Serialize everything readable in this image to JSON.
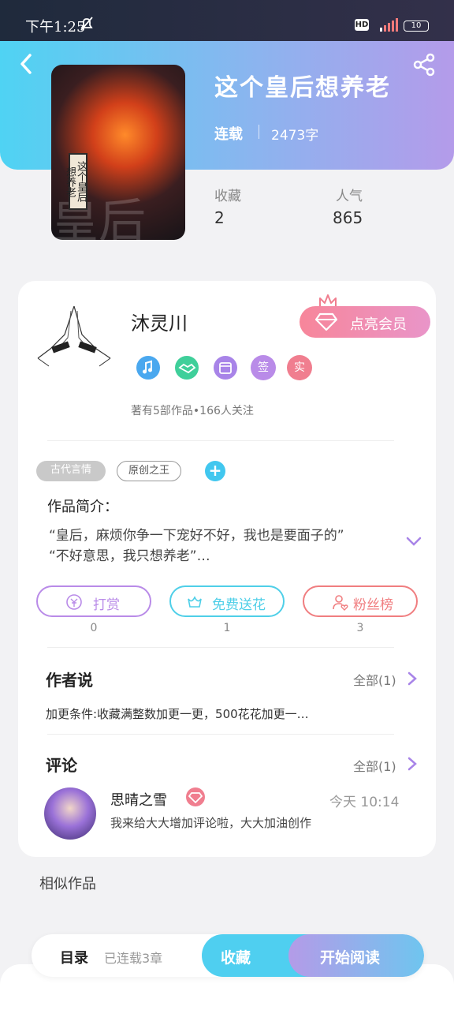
{
  "status_bar": {
    "time": "下午1:25",
    "hd": "HD",
    "battery": "10"
  },
  "book": {
    "title": "这个皇后想养老",
    "status": "连载",
    "words": "2473字",
    "cover_text": "这个皇后想养老",
    "cover_big": "皇后",
    "stats": [
      {
        "label": "收藏",
        "value": "2"
      },
      {
        "label": "人气",
        "value": "865"
      }
    ]
  },
  "author": {
    "name": "沐灵川",
    "vip_label": "点亮会员",
    "badges": [
      {
        "icon": "music-icon",
        "text": "",
        "color": "#4aa8ef"
      },
      {
        "icon": "handshake-icon",
        "text": "",
        "color": "#3fcf9a"
      },
      {
        "icon": "calendar-icon",
        "text": "",
        "color": "#a884e8"
      },
      {
        "icon": "sign-badge",
        "text": "签",
        "color": "#b98be8"
      },
      {
        "icon": "real-badge",
        "text": "实",
        "color": "#f07e8f"
      }
    ],
    "meta": "著有5部作品•166人关注"
  },
  "tags": [
    "古代言情",
    "原创之王"
  ],
  "intro": {
    "title": "作品简介：",
    "lines": [
      "“皇后，麻烦你争一下宠好不好，我也是要面子的”",
      "“不好意思，我只想养老”…"
    ]
  },
  "actions": [
    {
      "label": "打赏",
      "count": "0",
      "color": "#b98be8"
    },
    {
      "label": "免费送花",
      "count": "1",
      "color": "#4fcfe8"
    },
    {
      "label": "粉丝榜",
      "count": "3",
      "color": "#f07e80"
    }
  ],
  "author_says": {
    "title": "作者说",
    "see_all": "全部(1)",
    "text": "加更条件:收藏满整数加更一更，500花花加更一…"
  },
  "comments": {
    "title": "评论",
    "see_all": "全部(1)",
    "items": [
      {
        "name": "思晴之雪",
        "time": "今天  10:14",
        "text": "我来给大大增加评论啦，大大加油创作"
      }
    ]
  },
  "similar": {
    "title": "相似作品"
  },
  "bottom_bar": {
    "toc_label": "目录",
    "toc_status": "已连载3章",
    "collect_label": "收藏",
    "read_label": "开始阅读"
  },
  "colors": {
    "header_start": "#4fd3f3",
    "header_end": "#b49bea",
    "vip_pink": "#f7869a",
    "accent_blue": "#4fcff0"
  }
}
